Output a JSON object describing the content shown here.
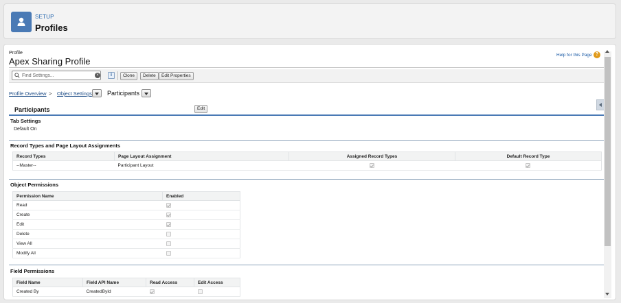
{
  "header": {
    "label": "SETUP",
    "title": "Profiles",
    "icon": "user-icon",
    "accent": "#4a7ab5"
  },
  "profile": {
    "sup_label": "Profile",
    "name": "Apex Sharing Profile",
    "help_link": "Help for this Page",
    "help_icon": "?"
  },
  "toolbar": {
    "search_placeholder": "Find Settings...",
    "search_value": "",
    "info_icon": "i",
    "clone_label": "Clone",
    "delete_label": "Delete",
    "edit_properties_label": "Edit Properties"
  },
  "breadcrumb": {
    "overview": "Profile Overview",
    "separator": ">",
    "object_settings": "Object Settings",
    "current": "Participants"
  },
  "section": {
    "title": "Participants",
    "edit_label": "Edit"
  },
  "tab_settings": {
    "title": "Tab Settings",
    "value": "Default On"
  },
  "record_types": {
    "title": "Record Types and Page Layout Assignments",
    "headers": [
      "Record Types",
      "Page Layout Assignment",
      "Assigned Record Types",
      "Default Record Type"
    ],
    "rows": [
      {
        "record_type": "--Master--",
        "layout": "Participant Layout",
        "assigned": true,
        "default": true
      }
    ]
  },
  "object_permissions": {
    "title": "Object Permissions",
    "headers": [
      "Permission Name",
      "Enabled"
    ],
    "rows": [
      {
        "name": "Read",
        "enabled": true
      },
      {
        "name": "Create",
        "enabled": true
      },
      {
        "name": "Edit",
        "enabled": true
      },
      {
        "name": "Delete",
        "enabled": false
      },
      {
        "name": "View All",
        "enabled": false
      },
      {
        "name": "Modify All",
        "enabled": false
      }
    ]
  },
  "field_permissions": {
    "title": "Field Permissions",
    "headers": [
      "Field Name",
      "Field API Name",
      "Read Access",
      "Edit Access"
    ],
    "rows": [
      {
        "name": "Created By",
        "api": "CreatedById",
        "read": true,
        "edit": false
      }
    ]
  }
}
